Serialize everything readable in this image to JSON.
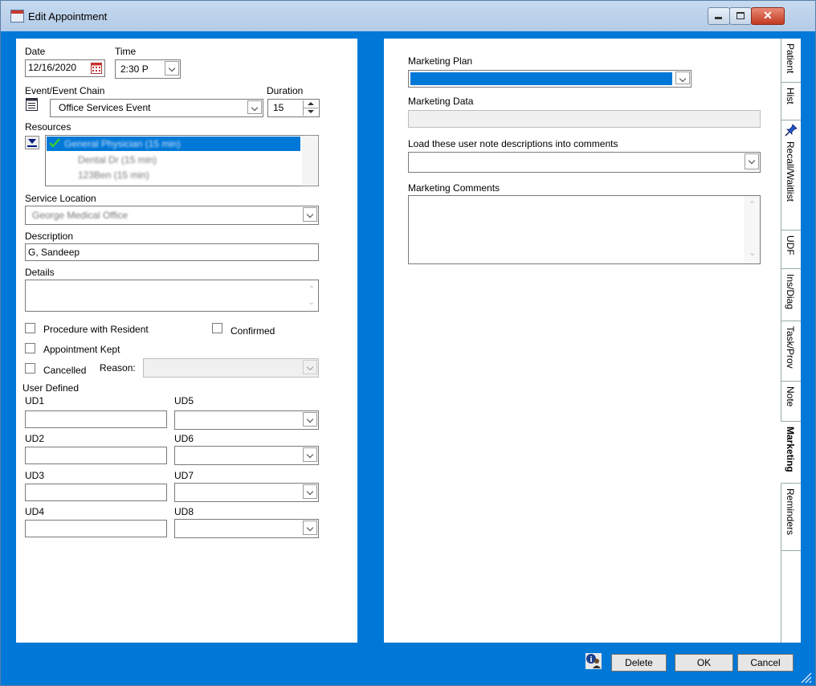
{
  "window": {
    "title": "Edit Appointment"
  },
  "left": {
    "date_label": "Date",
    "date_value": "12/16/2020",
    "time_label": "Time",
    "time_value": "2:30 P",
    "event_label": "Event/Event Chain",
    "event_value": "Office Services Event",
    "duration_label": "Duration",
    "duration_value": "15",
    "resources_label": "Resources",
    "resources": [
      "General Physician (15 min)",
      "Dental Dr (15 min)",
      "123Ben (15 min)"
    ],
    "service_location_label": "Service Location",
    "service_location_value": "George Medical Office",
    "description_label": "Description",
    "description_value": "G, Sandeep",
    "details_label": "Details",
    "procedure_label": "Procedure with Resident",
    "confirmed_label": "Confirmed",
    "kept_label": "Appointment Kept",
    "cancelled_label": "Cancelled",
    "reason_label": "Reason:",
    "user_defined_label": "User Defined",
    "ud": [
      "UD1",
      "UD2",
      "UD3",
      "UD4",
      "UD5",
      "UD6",
      "UD7",
      "UD8"
    ]
  },
  "right": {
    "marketing_plan_label": "Marketing Plan",
    "marketing_data_label": "Marketing Data",
    "load_notes_label": "Load these user note descriptions into comments",
    "marketing_comments_label": "Marketing Comments"
  },
  "tabs": [
    "Patient",
    "Hist",
    "Recall/Waitlist",
    "UDF",
    "Ins/Diag",
    "Task/Prov",
    "Note",
    "Marketing",
    "Reminders"
  ],
  "active_tab": "Marketing",
  "buttons": {
    "delete": "Delete",
    "ok": "OK",
    "cancel": "Cancel"
  },
  "colors": {
    "frame": "#0078d7",
    "selection": "#0078d7"
  }
}
